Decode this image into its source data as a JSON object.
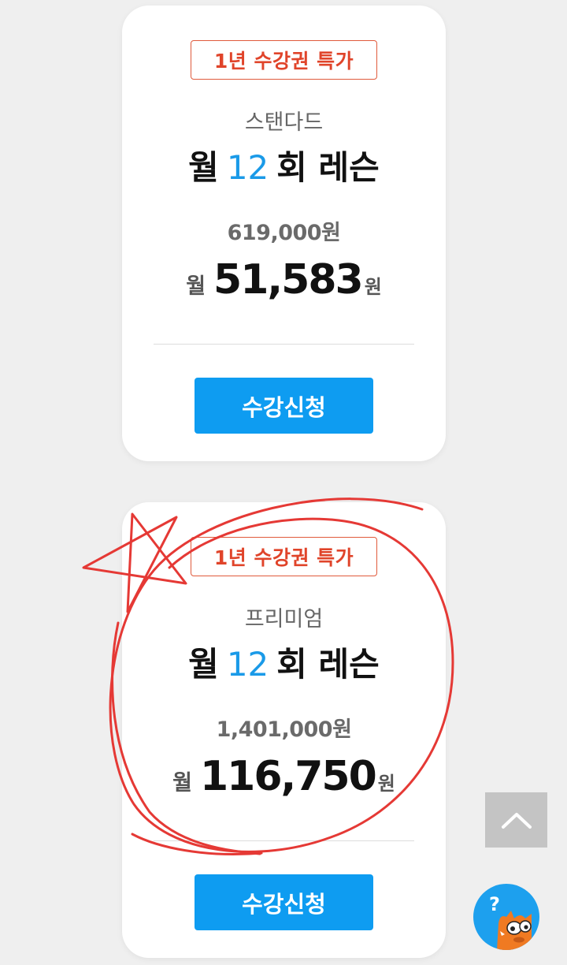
{
  "cards": [
    {
      "badge": "1년 수강권 특가",
      "plan": "스탠다드",
      "lesson_prefix": "월",
      "lesson_count": "12",
      "lesson_suffix": "회 레슨",
      "total_price": "619,000원",
      "monthly_prefix": "월",
      "monthly_amount": "51,583",
      "monthly_suffix": "원",
      "button": "수강신청"
    },
    {
      "badge": "1년 수강권 특가",
      "plan": "프리미엄",
      "lesson_prefix": "월",
      "lesson_count": "12",
      "lesson_suffix": "회 레슨",
      "total_price": "1,401,000원",
      "monthly_prefix": "월",
      "monthly_amount": "116,750",
      "monthly_suffix": "원",
      "button": "수강신청"
    }
  ],
  "help_button": {
    "icon": "question-mark",
    "label": "?"
  },
  "scroll_top": {
    "icon": "chevron-up-icon"
  },
  "colors": {
    "badge": "#e0442a",
    "accent_blue": "#1a9ae8",
    "button": "#0e9cf1",
    "annotation_red": "#e53935",
    "background": "#efefef"
  }
}
